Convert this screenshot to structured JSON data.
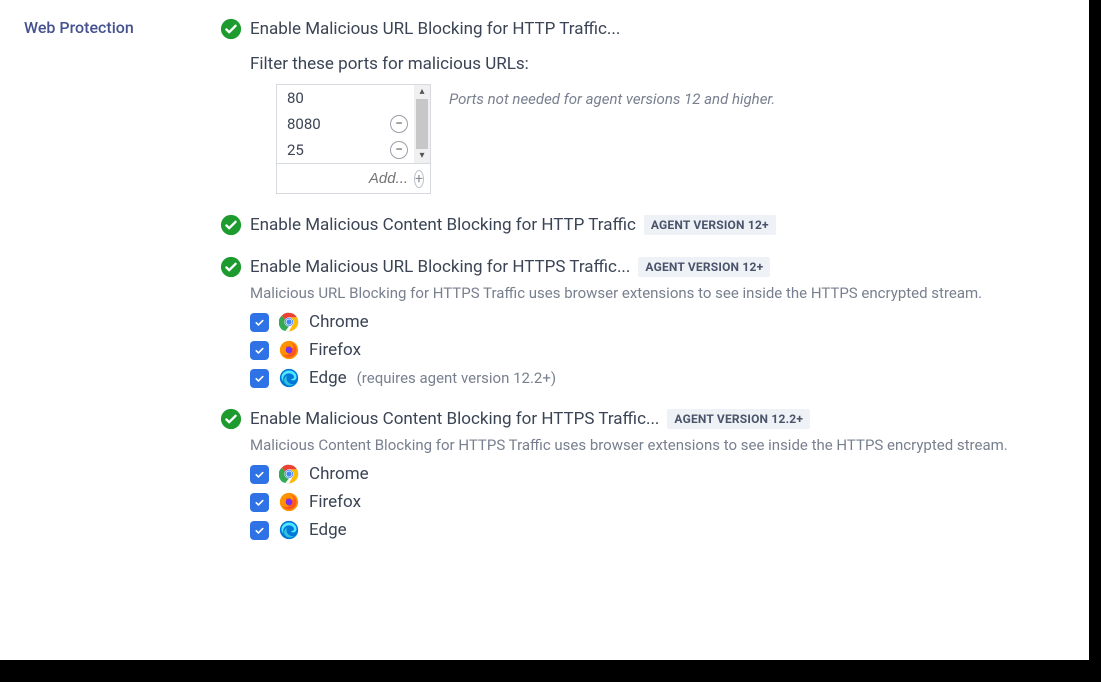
{
  "sidebar": {
    "section_label": "Web Protection"
  },
  "section1": {
    "title": "Enable Malicious URL Blocking for HTTP Traffic...",
    "filter_label": "Filter these ports for malicious URLs:",
    "ports": [
      "80",
      "8080",
      "25"
    ],
    "add_placeholder": "Add...",
    "ports_note": "Ports not needed for agent versions 12 and higher."
  },
  "section2": {
    "title": "Enable Malicious Content Blocking for HTTP Traffic",
    "badge": "AGENT VERSION 12+"
  },
  "section3": {
    "title": "Enable Malicious URL Blocking for HTTPS Traffic...",
    "badge": "AGENT VERSION 12+",
    "desc": "Malicious URL Blocking for HTTPS Traffic uses browser extensions to see inside the HTTPS encrypted stream.",
    "browsers": [
      {
        "name": "Chrome",
        "note": ""
      },
      {
        "name": "Firefox",
        "note": ""
      },
      {
        "name": "Edge",
        "note": "(requires agent version 12.2+)"
      }
    ]
  },
  "section4": {
    "title": "Enable Malicious Content Blocking for HTTPS Traffic...",
    "badge": "AGENT VERSION 12.2+",
    "desc": "Malicious Content Blocking for HTTPS Traffic uses browser extensions to see inside the HTTPS encrypted stream.",
    "browsers": [
      {
        "name": "Chrome",
        "note": ""
      },
      {
        "name": "Firefox",
        "note": ""
      },
      {
        "name": "Edge",
        "note": ""
      }
    ]
  }
}
